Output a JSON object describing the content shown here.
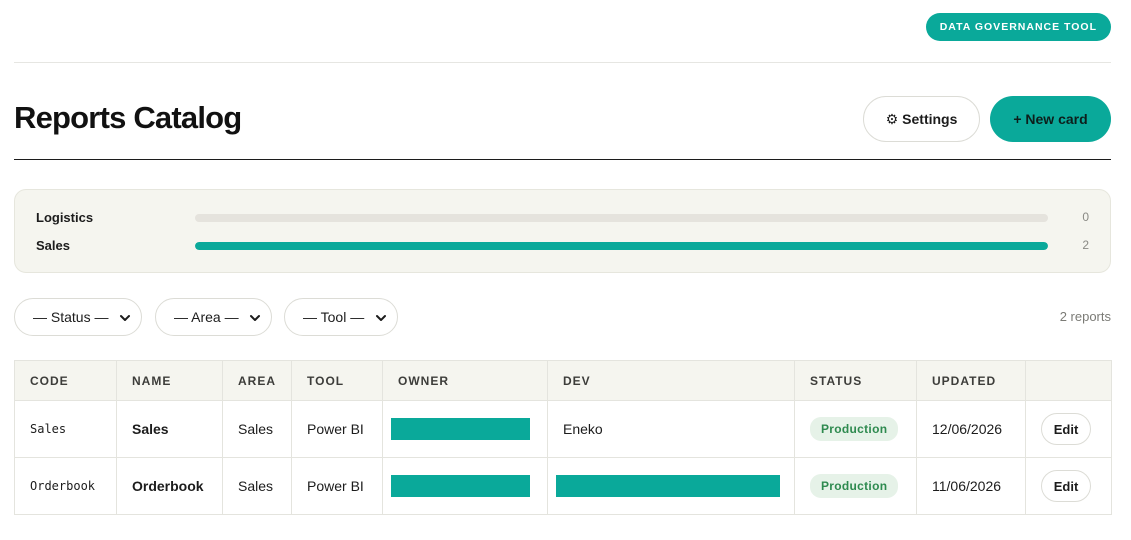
{
  "app": {
    "tag": "DATA GOVERNANCE TOOL"
  },
  "header": {
    "title": "Reports Catalog",
    "settings_icon": "⚙",
    "settings_label": "Settings",
    "new_card_label": "+ New card"
  },
  "summary": {
    "rows": [
      {
        "label": "Logistics",
        "count": "0",
        "fraction": 0
      },
      {
        "label": "Sales",
        "count": "2",
        "fraction": 1
      }
    ]
  },
  "filters": {
    "status": "— Status —",
    "area": "— Area —",
    "tool": "— Tool —",
    "count": "2 reports"
  },
  "table": {
    "columns": [
      "CODE",
      "NAME",
      "AREA",
      "TOOL",
      "OWNER",
      "DEV",
      "STATUS",
      "UPDATED",
      ""
    ],
    "rows": [
      {
        "code": "Sales",
        "name": "Sales",
        "area": "Sales",
        "tool": "Power BI",
        "dev": "Eneko",
        "status": "Production",
        "updated": "12/06/2026",
        "action": "Edit"
      },
      {
        "code": "Orderbook",
        "name": "Orderbook",
        "area": "Sales",
        "tool": "Power BI",
        "dev": "",
        "status": "Production",
        "updated": "11/06/2026",
        "action": "Edit"
      }
    ]
  },
  "colors": {
    "accent": "#0aa99a",
    "panel_bg": "#f5f5ef",
    "badge_bg": "#e6f2e8",
    "badge_text": "#2e8a4f"
  }
}
